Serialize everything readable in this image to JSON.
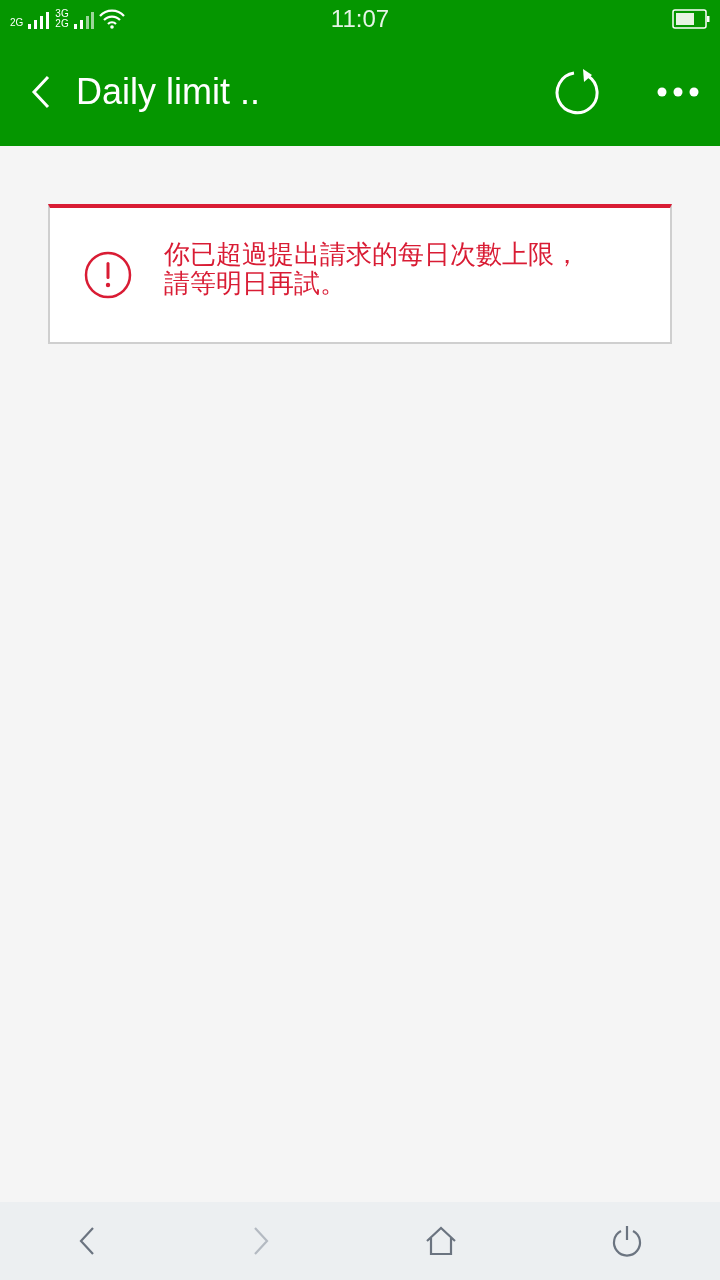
{
  "status_bar": {
    "network_1": "2G",
    "network_2_top": "3G",
    "network_2_bottom": "2G",
    "time": "11:07"
  },
  "app_bar": {
    "title": "Daily limit .."
  },
  "error_card": {
    "message": "你已超過提出請求的每日次數上限，請等明日再試。"
  },
  "bottom_bar": [
    {
      "kind": "back",
      "disabled": false
    },
    {
      "kind": "forward",
      "disabled": true
    },
    {
      "kind": "home",
      "disabled": false
    },
    {
      "kind": "power",
      "disabled": false
    }
  ]
}
